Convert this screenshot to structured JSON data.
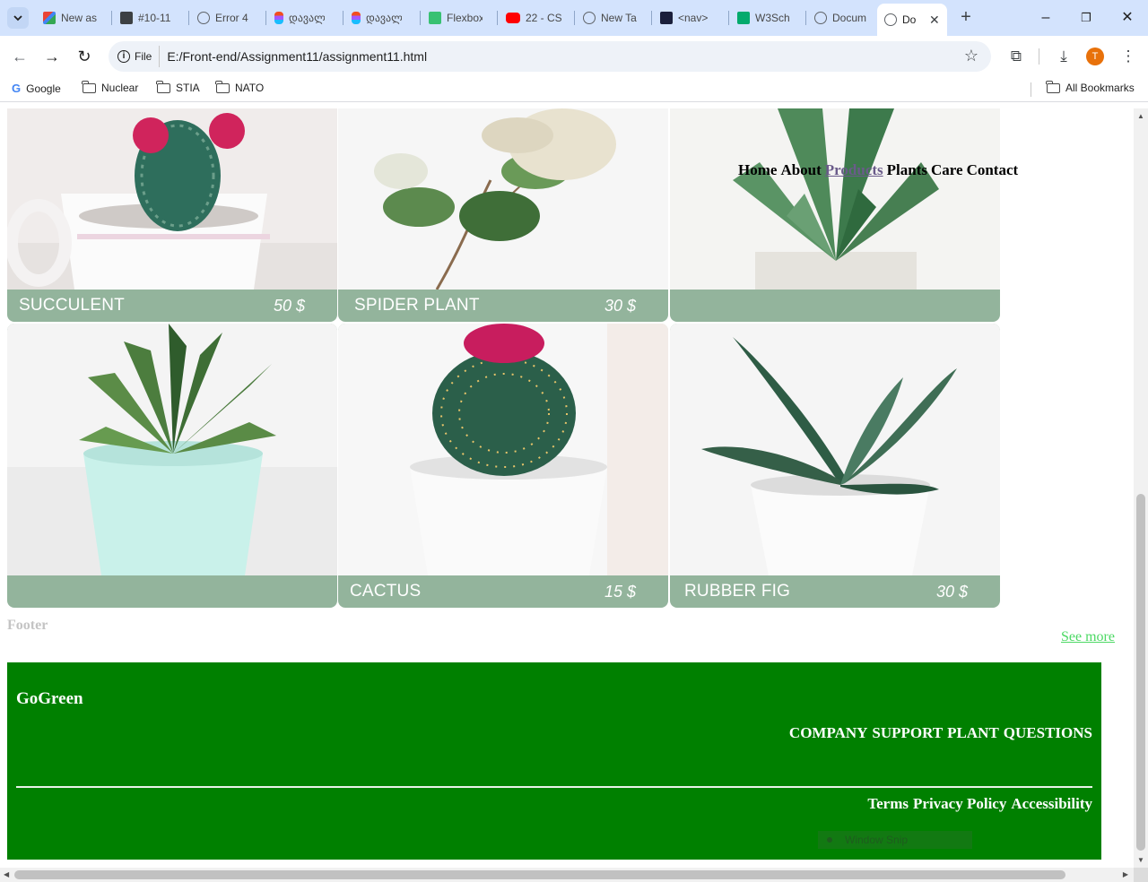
{
  "browser": {
    "tabs": [
      {
        "label": "New as",
        "icon": "gmail-icon"
      },
      {
        "label": "#10-11",
        "icon": "contact-card-icon"
      },
      {
        "label": "Error 4",
        "icon": "globe-icon"
      },
      {
        "label": "დავალ",
        "icon": "figma-icon"
      },
      {
        "label": "დავალ",
        "icon": "figma-icon"
      },
      {
        "label": "Flexbox",
        "icon": "flexbox-icon"
      },
      {
        "label": "22 - CS",
        "icon": "youtube-icon"
      },
      {
        "label": "New Ta",
        "icon": "globe-icon"
      },
      {
        "label": "<nav>",
        "icon": "nav-icon"
      },
      {
        "label": "W3Sch",
        "icon": "w3schools-icon"
      },
      {
        "label": "Docum",
        "icon": "globe-icon"
      },
      {
        "label": "Do",
        "icon": "globe-icon",
        "active": true
      }
    ],
    "address": {
      "chip": "File",
      "url": "E:/Front-end/Assignment11/assignment11.html"
    },
    "profile_initial": "T",
    "bookmarks": [
      "Google",
      "Nuclear",
      "STIA",
      "NATO"
    ],
    "all_bookmarks": "All Bookmarks"
  },
  "page": {
    "nav": [
      "Home",
      "About",
      "Products",
      "Plants",
      "Care",
      "Contact"
    ],
    "products": [
      {
        "name": "SUCCULENT",
        "price": "50 $"
      },
      {
        "name": "SPIDER PLANT",
        "price": "30 $"
      },
      {
        "name": "",
        "price": ""
      },
      {
        "name": "",
        "price": ""
      },
      {
        "name": "CACTUS",
        "price": "15 $"
      },
      {
        "name": "RUBBER FIG",
        "price": "30 $"
      }
    ],
    "footer_label": "Footer",
    "see_more": "See more",
    "footer": {
      "brand": "GoGreen",
      "links": [
        "COMPANY",
        "SUPPORT",
        "PLANT",
        "QUESTIONS"
      ],
      "legal": [
        "Terms",
        "Privacy Policy",
        "Accessibility"
      ],
      "snip_overlay": "Window Snip"
    }
  },
  "colors": {
    "card_bar": "#93b49c",
    "footer_bg": "#008000",
    "see_more": "#4cd964",
    "tabstrip": "#d3e3fd"
  }
}
